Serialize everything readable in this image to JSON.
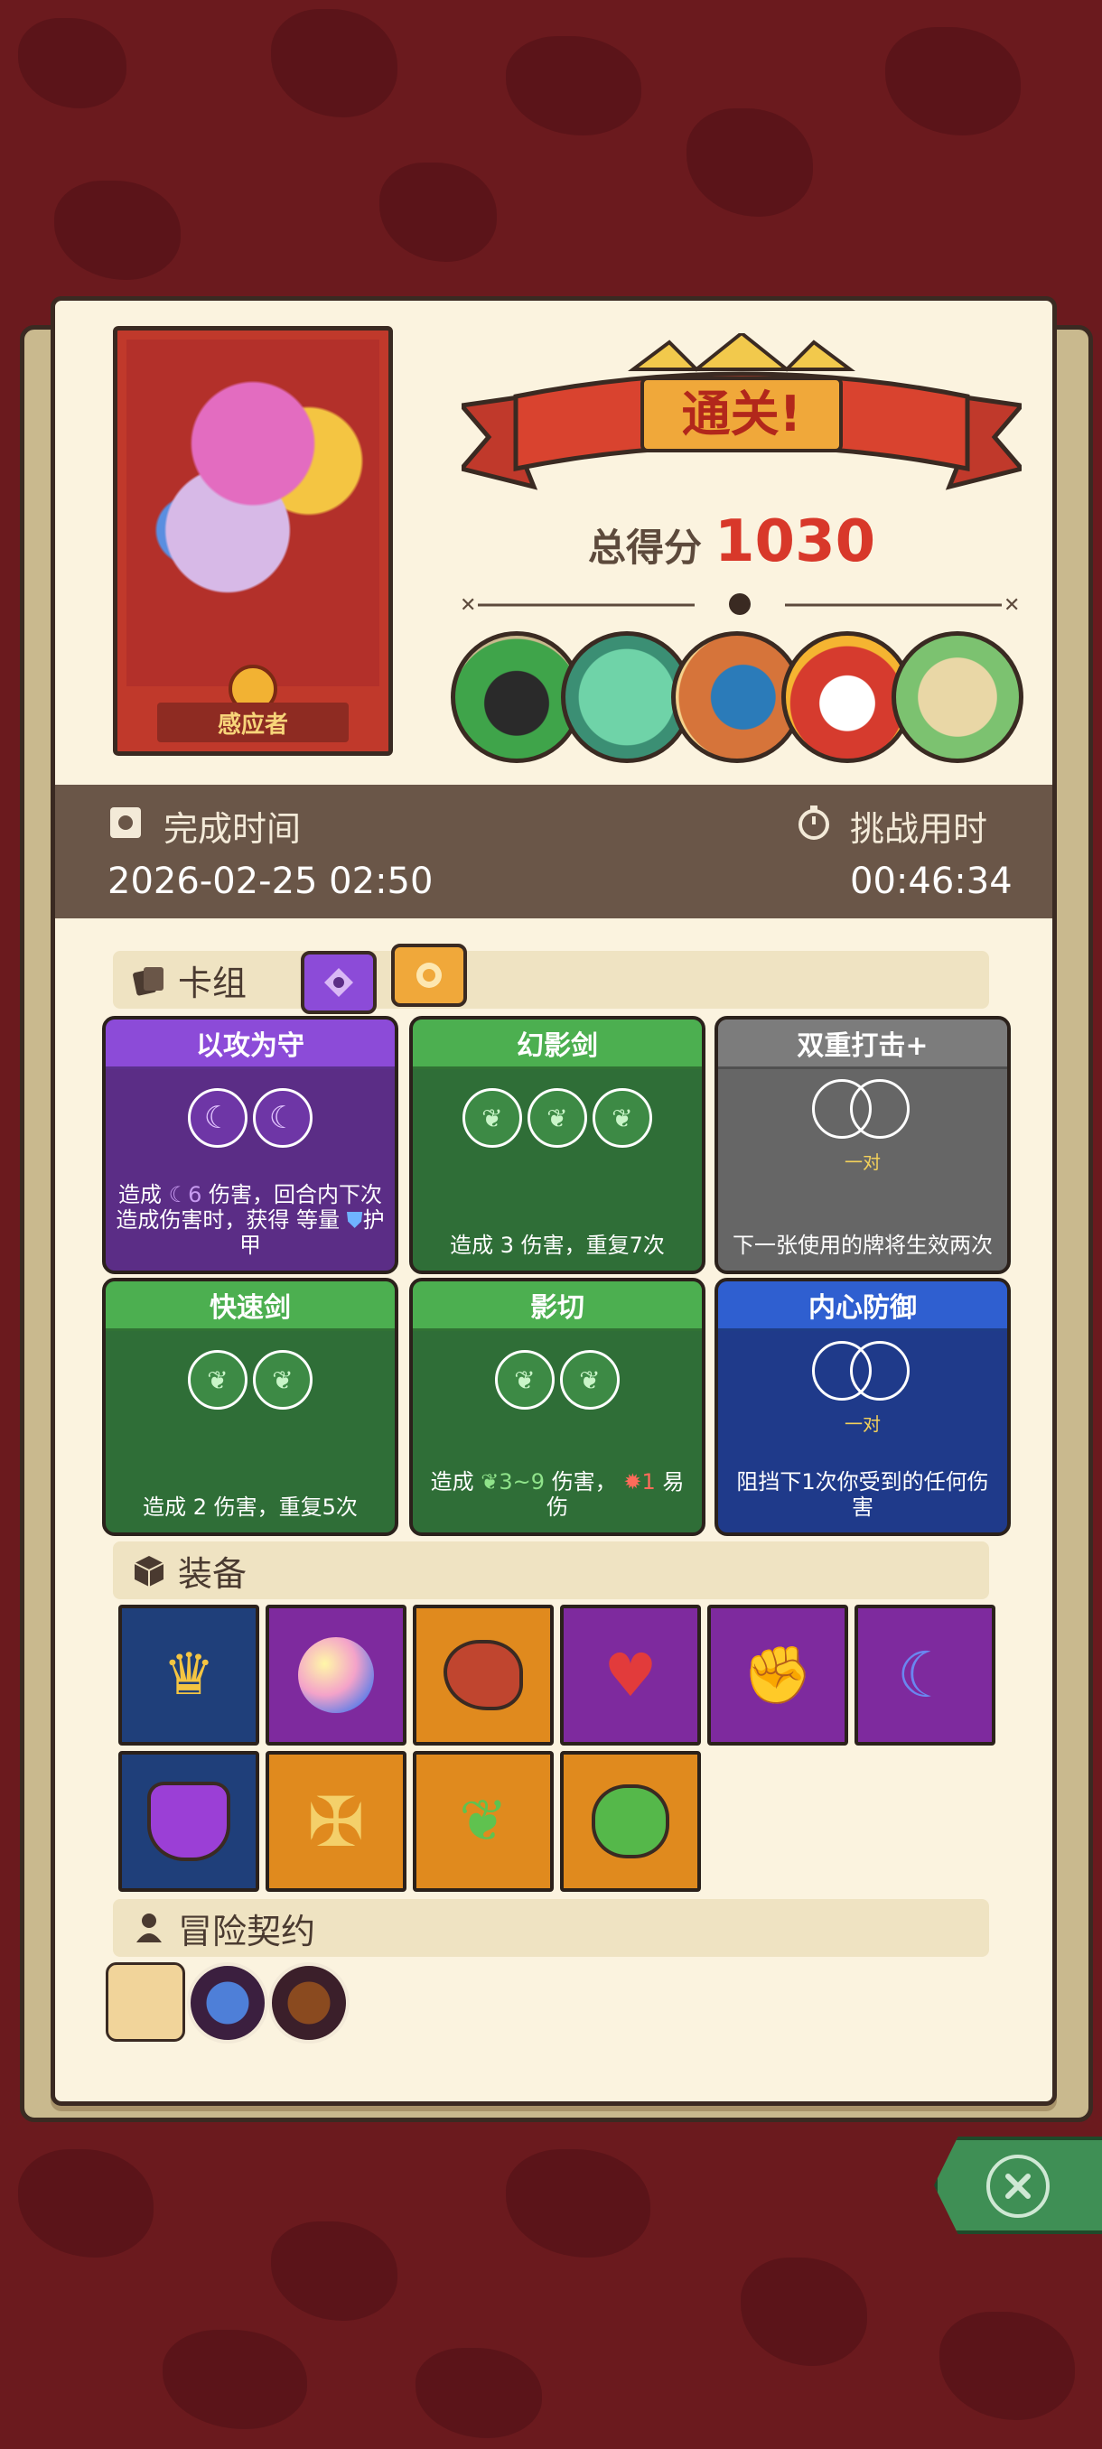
{
  "character": {
    "name": "感应者"
  },
  "result": {
    "banner_text": "通关!",
    "score_label": "总得分",
    "score_value": "1030"
  },
  "bosses": [
    "tank-knight",
    "fish-monster",
    "wrestler-beast",
    "oni-mask",
    "forest-elf"
  ],
  "times": {
    "complete_label": "完成时间",
    "complete_value": "2026-02-25 02:50",
    "challenge_label": "挑战用时",
    "challenge_value": "00:46:34"
  },
  "deck": {
    "title": "卡组",
    "cards": [
      {
        "title": "以攻为守",
        "color": "#5b2d86",
        "head": "#8c4bd8",
        "desc_pre": "造成",
        "desc_val": "6",
        "desc_post": "伤害，回合内下次造成伤害时，获得 等量",
        "desc_tail": "护甲"
      },
      {
        "title": "幻影剑",
        "color": "#2f6e37",
        "head": "#4caf50",
        "desc": "造成 3 伤害，重复7次"
      },
      {
        "title": "双重打击+",
        "color": "#666666",
        "head": "#7c7c7c",
        "pair_label": "一对",
        "desc": "下一张使用的牌将生效两次"
      },
      {
        "title": "快速剑",
        "color": "#2f6e37",
        "head": "#4caf50",
        "desc": "造成 2 伤害，重复5次"
      },
      {
        "title": "影切",
        "color": "#2f6e37",
        "head": "#4caf50",
        "desc_pre": "造成",
        "desc_val": "3~9",
        "desc_mid": "伤害，",
        "desc_val2": "1",
        "desc_post": "易伤"
      },
      {
        "title": "内心防御",
        "color": "#1f3a8a",
        "head": "#2f5fd0",
        "pair_label": "一对",
        "desc": "阻挡下1次你受到的任何伤害"
      }
    ]
  },
  "equipment": {
    "title": "装备",
    "items": [
      {
        "name": "golden-crown",
        "bg": "#1f3f7a"
      },
      {
        "name": "crystal-orb",
        "bg": "#7e2a9e"
      },
      {
        "name": "meat-leg",
        "bg": "#e08a1e"
      },
      {
        "name": "heart-stone",
        "bg": "#7e2a9e"
      },
      {
        "name": "golden-gauntlet",
        "bg": "#7e2a9e"
      },
      {
        "name": "moon-blade",
        "bg": "#7e2a9e"
      },
      {
        "name": "purple-potion-jug",
        "bg": "#1f3f7a"
      },
      {
        "name": "golden-cross-shield",
        "bg": "#e08a1e"
      },
      {
        "name": "green-feather",
        "bg": "#e08a1e"
      },
      {
        "name": "green-potion",
        "bg": "#e08a1e"
      }
    ]
  },
  "contract": {
    "title": "冒险契约",
    "items": [
      "scroll",
      "mushroom-monster",
      "pipe"
    ]
  }
}
